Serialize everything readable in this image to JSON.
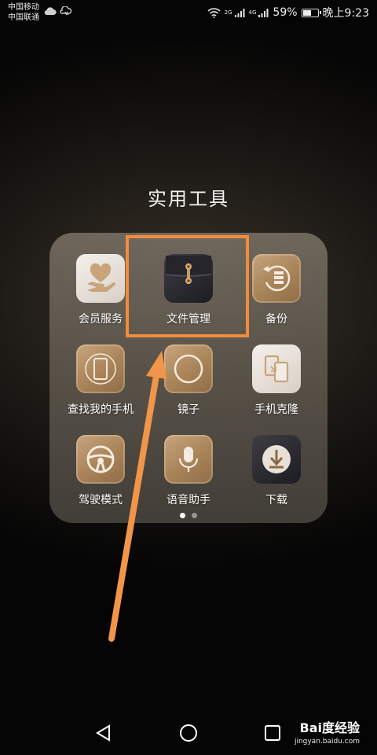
{
  "status_bar": {
    "carrier1": "中国移动",
    "carrier2": "中国联通",
    "net1": "2G",
    "net2": "4G",
    "battery_text": "59%",
    "battery_level": 0.59,
    "time": "晚上9:23",
    "icons": [
      "cloud-icon",
      "weather-icon",
      "wifi-icon",
      "signal-icon",
      "battery-icon"
    ]
  },
  "folder": {
    "title": "实用工具",
    "apps": [
      {
        "label": "会员服务",
        "icon": "hand-heart-icon"
      },
      {
        "label": "文件管理",
        "icon": "file-folder-icon"
      },
      {
        "label": "备份",
        "icon": "backup-icon"
      },
      {
        "label": "查找我的手机",
        "icon": "find-phone-icon"
      },
      {
        "label": "镜子",
        "icon": "mirror-icon"
      },
      {
        "label": "手机克隆",
        "icon": "phone-clone-icon"
      },
      {
        "label": "驾驶模式",
        "icon": "steering-wheel-icon"
      },
      {
        "label": "语音助手",
        "icon": "microphone-icon"
      },
      {
        "label": "下载",
        "icon": "download-icon"
      }
    ],
    "page_count": 2,
    "current_page": 1
  },
  "annotation": {
    "highlight_color": "#f08c3c",
    "arrow_color": "#f0954a"
  },
  "navbar": {
    "buttons": [
      "back-icon",
      "home-icon",
      "recents-icon"
    ]
  },
  "watermark": {
    "logo": "Bai度经验",
    "url": "jingyan.baidu.com"
  }
}
